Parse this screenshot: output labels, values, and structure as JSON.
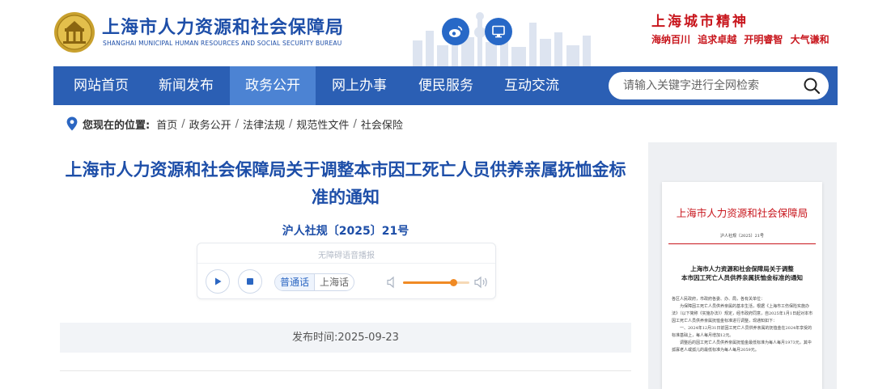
{
  "header": {
    "title": "上海市人力资源和社会保障局",
    "subtitle": "SHANGHAI MUNICIPAL HUMAN RESOURCES AND SOCIAL SECURITY BUREAU",
    "logo_icon": "emblem-icon",
    "social_icons": [
      "weibo-icon",
      "desktop-icon"
    ],
    "city_spirit": {
      "title": "上海城市精神",
      "words": [
        "海纳百川",
        "追求卓越",
        "开明睿智",
        "大气谦和"
      ]
    }
  },
  "nav": {
    "items": [
      "网站首页",
      "新闻发布",
      "政务公开",
      "网上办事",
      "便民服务",
      "互动交流"
    ],
    "active": "政务公开",
    "search_placeholder": "请输入关键字进行全网检索",
    "colors": {
      "bar": "#2b5fb4",
      "active": "#4c83d3"
    }
  },
  "breadcrumb": {
    "label": "您现在的位置:",
    "items": [
      "首页",
      "政务公开",
      "法律法规",
      "规范性文件",
      "社会保险"
    ]
  },
  "article": {
    "title": "上海市人力资源和社会保障局关于调整本市因工死亡人员供养亲属抚恤金标准的通知",
    "doc_number": "沪人社规〔2025〕21号",
    "publish_label": "发布时间:",
    "publish_date": "2025-09-23"
  },
  "player": {
    "label": "无障碍语音播报",
    "languages": [
      "普通话",
      "上海话"
    ],
    "selected_language": "普通话",
    "volume": 0.75,
    "icons": [
      "play-icon",
      "stop-icon",
      "volume-low-icon",
      "volume-high-icon"
    ]
  },
  "preview": {
    "header": "上海市人力资源和社会保障局",
    "doc_number": "沪人社规〔2025〕21号",
    "title_lines": [
      "上海市人力资源和社会保障局关于调整",
      "本市因工死亡人员供养亲属抚恤金标准的通知"
    ],
    "body": [
      "各区人民政府，市政府各委、办、局，各有关单位：",
      "为保障因工死亡人员供养亲属的基本生活，根据《上海市工伤保险实施办法》（以下简称《实施办法》）规定，经市政府同意，自2025年1月1日起对本市因工死亡人员供养亲属抚恤金标准进行调整，现通知如下：",
      "一、2024年12月31日前因工死亡人员供养亲属的抚恤金在2024年享受的标准基础上，每人每月增加12元。",
      "调整后的因工死亡人员供养亲属抚恤金最低标准为每人每月1973元，其中孤寡老人或孤儿的最低标准为每人每月2059元。"
    ]
  },
  "colors": {
    "brand_blue": "#1d4ea8",
    "accent_red": "#c8161d",
    "volume_orange": "#f08a24"
  }
}
